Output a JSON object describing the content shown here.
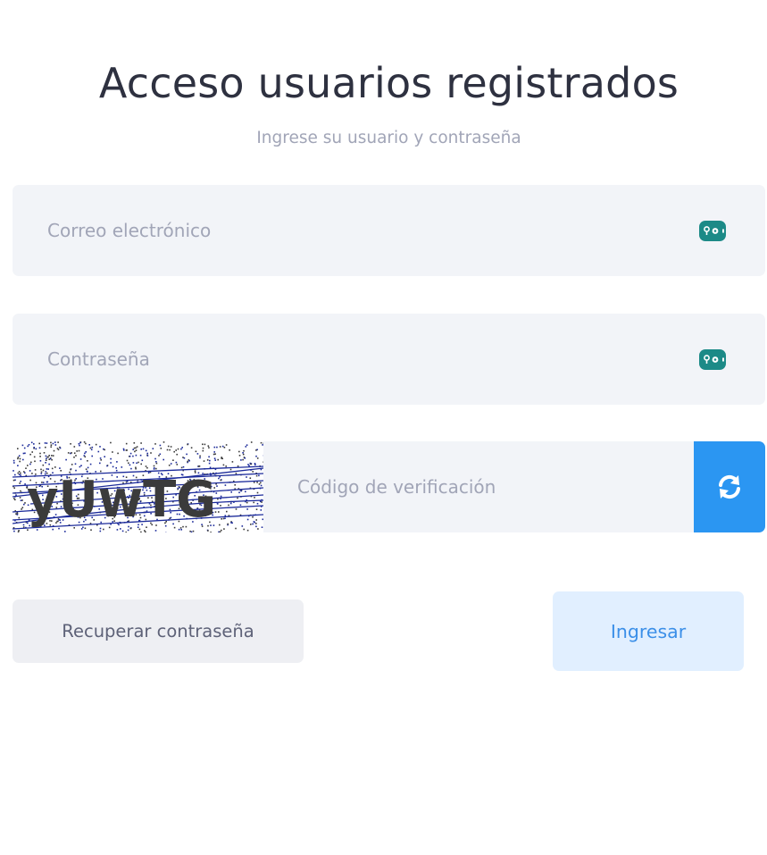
{
  "header": {
    "title": "Acceso usuarios registrados",
    "subtitle": "Ingrese su usuario y contraseña"
  },
  "form": {
    "email": {
      "value": "",
      "placeholder": "Correo electrónico",
      "icon": "password-manager-icon"
    },
    "password": {
      "value": "",
      "placeholder": "Contraseña",
      "icon": "password-manager-icon"
    },
    "captcha": {
      "image_text": "yUwTG",
      "code_value": "",
      "code_placeholder": "Código de verificación",
      "refresh_icon": "refresh-icon"
    }
  },
  "actions": {
    "recover_label": "Recuperar contraseña",
    "login_label": "Ingresar"
  },
  "colors": {
    "title": "#2e3140",
    "muted": "#a1a5b7",
    "field_bg": "#f2f4f8",
    "icon_teal": "#1c8a87",
    "refresh_bg": "#2b96f2",
    "recover_bg": "#eeeff3",
    "login_bg": "#e1efff",
    "login_text": "#3b8fe8"
  }
}
